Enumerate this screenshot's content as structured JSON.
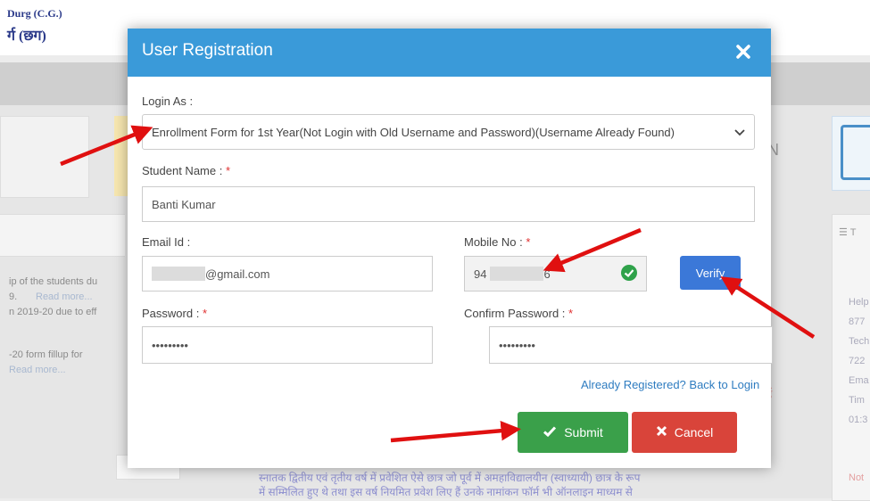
{
  "background": {
    "logo_line1": "Durg (C.G.)",
    "logo_line2": "र्ग (छग)",
    "news": [
      "ip of the students du",
      "9.",
      "Read more...",
      "n 2019-20 due to eff",
      "-20 form fillup for",
      "Read more..."
    ],
    "card_letter": "N",
    "right_panel": [
      "Help",
      "877",
      "Tech",
      "722",
      "Ema",
      "Tim",
      "01:3",
      "Not"
    ],
    "right_panel_header": "T",
    "hindi_line1": "स्नातक द्वितीय एवं तृतीय वर्ष में प्रवेशित ऐसे छात्र जो पूर्व में अमहाविद्यालयीन (स्वाध्यायी) छात्र के रूप",
    "hindi_line2": "में सम्मिलित हुए थे तथा इस वर्ष नियमित प्रवेश लिए हैं उनके नामांकन फॉर्म भी ऑनलाइन माध्यम से",
    "hindi_side": "हैं"
  },
  "modal": {
    "title": "User Registration",
    "close_icon": "close-icon",
    "login_as_label": "Login As :",
    "login_as_value": "Enrollment Form for 1st Year(Not Login with Old Username and Password)(Username Already Found)",
    "student_name_label": "Student Name :",
    "student_name_value": "Banti Kumar",
    "email_label": "Email Id :",
    "email_value": "@gmail.com",
    "mobile_label": "Mobile No :",
    "mobile_prefix": "94",
    "mobile_suffix": "6",
    "verify_label": "Verify",
    "password_label": "Password :",
    "password_value": "•••••••••",
    "confirm_password_label": "Confirm Password :",
    "confirm_password_value": "•••••••••",
    "back_to_login": "Already Registered? Back to Login",
    "submit_label": "Submit",
    "cancel_label": "Cancel",
    "required_mark": "*"
  },
  "colors": {
    "header_blue": "#3a9ad9",
    "submit_green": "#3aa04a",
    "cancel_red": "#d9443a",
    "verify_blue": "#3b78d8",
    "arrow_red": "#e01010"
  }
}
